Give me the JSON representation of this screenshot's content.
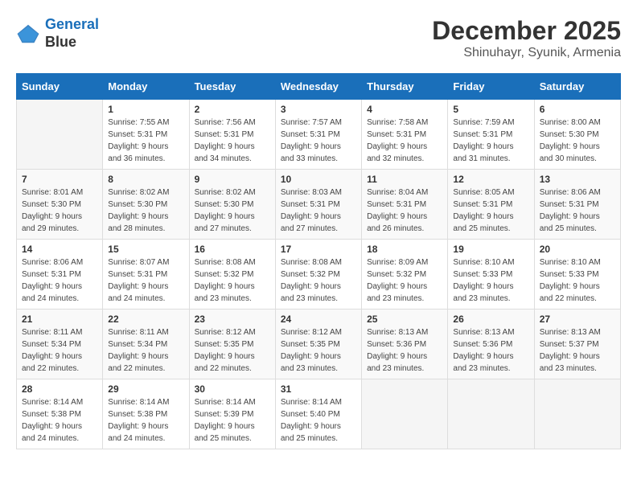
{
  "header": {
    "logo_line1": "General",
    "logo_line2": "Blue",
    "month": "December 2025",
    "location": "Shinuhayr, Syunik, Armenia"
  },
  "weekdays": [
    "Sunday",
    "Monday",
    "Tuesday",
    "Wednesday",
    "Thursday",
    "Friday",
    "Saturday"
  ],
  "weeks": [
    [
      {
        "day": "",
        "sunrise": "",
        "sunset": "",
        "daylight": ""
      },
      {
        "day": "1",
        "sunrise": "Sunrise: 7:55 AM",
        "sunset": "Sunset: 5:31 PM",
        "daylight": "Daylight: 9 hours and 36 minutes."
      },
      {
        "day": "2",
        "sunrise": "Sunrise: 7:56 AM",
        "sunset": "Sunset: 5:31 PM",
        "daylight": "Daylight: 9 hours and 34 minutes."
      },
      {
        "day": "3",
        "sunrise": "Sunrise: 7:57 AM",
        "sunset": "Sunset: 5:31 PM",
        "daylight": "Daylight: 9 hours and 33 minutes."
      },
      {
        "day": "4",
        "sunrise": "Sunrise: 7:58 AM",
        "sunset": "Sunset: 5:31 PM",
        "daylight": "Daylight: 9 hours and 32 minutes."
      },
      {
        "day": "5",
        "sunrise": "Sunrise: 7:59 AM",
        "sunset": "Sunset: 5:31 PM",
        "daylight": "Daylight: 9 hours and 31 minutes."
      },
      {
        "day": "6",
        "sunrise": "Sunrise: 8:00 AM",
        "sunset": "Sunset: 5:30 PM",
        "daylight": "Daylight: 9 hours and 30 minutes."
      }
    ],
    [
      {
        "day": "7",
        "sunrise": "Sunrise: 8:01 AM",
        "sunset": "Sunset: 5:30 PM",
        "daylight": "Daylight: 9 hours and 29 minutes."
      },
      {
        "day": "8",
        "sunrise": "Sunrise: 8:02 AM",
        "sunset": "Sunset: 5:30 PM",
        "daylight": "Daylight: 9 hours and 28 minutes."
      },
      {
        "day": "9",
        "sunrise": "Sunrise: 8:02 AM",
        "sunset": "Sunset: 5:30 PM",
        "daylight": "Daylight: 9 hours and 27 minutes."
      },
      {
        "day": "10",
        "sunrise": "Sunrise: 8:03 AM",
        "sunset": "Sunset: 5:31 PM",
        "daylight": "Daylight: 9 hours and 27 minutes."
      },
      {
        "day": "11",
        "sunrise": "Sunrise: 8:04 AM",
        "sunset": "Sunset: 5:31 PM",
        "daylight": "Daylight: 9 hours and 26 minutes."
      },
      {
        "day": "12",
        "sunrise": "Sunrise: 8:05 AM",
        "sunset": "Sunset: 5:31 PM",
        "daylight": "Daylight: 9 hours and 25 minutes."
      },
      {
        "day": "13",
        "sunrise": "Sunrise: 8:06 AM",
        "sunset": "Sunset: 5:31 PM",
        "daylight": "Daylight: 9 hours and 25 minutes."
      }
    ],
    [
      {
        "day": "14",
        "sunrise": "Sunrise: 8:06 AM",
        "sunset": "Sunset: 5:31 PM",
        "daylight": "Daylight: 9 hours and 24 minutes."
      },
      {
        "day": "15",
        "sunrise": "Sunrise: 8:07 AM",
        "sunset": "Sunset: 5:31 PM",
        "daylight": "Daylight: 9 hours and 24 minutes."
      },
      {
        "day": "16",
        "sunrise": "Sunrise: 8:08 AM",
        "sunset": "Sunset: 5:32 PM",
        "daylight": "Daylight: 9 hours and 23 minutes."
      },
      {
        "day": "17",
        "sunrise": "Sunrise: 8:08 AM",
        "sunset": "Sunset: 5:32 PM",
        "daylight": "Daylight: 9 hours and 23 minutes."
      },
      {
        "day": "18",
        "sunrise": "Sunrise: 8:09 AM",
        "sunset": "Sunset: 5:32 PM",
        "daylight": "Daylight: 9 hours and 23 minutes."
      },
      {
        "day": "19",
        "sunrise": "Sunrise: 8:10 AM",
        "sunset": "Sunset: 5:33 PM",
        "daylight": "Daylight: 9 hours and 23 minutes."
      },
      {
        "day": "20",
        "sunrise": "Sunrise: 8:10 AM",
        "sunset": "Sunset: 5:33 PM",
        "daylight": "Daylight: 9 hours and 22 minutes."
      }
    ],
    [
      {
        "day": "21",
        "sunrise": "Sunrise: 8:11 AM",
        "sunset": "Sunset: 5:34 PM",
        "daylight": "Daylight: 9 hours and 22 minutes."
      },
      {
        "day": "22",
        "sunrise": "Sunrise: 8:11 AM",
        "sunset": "Sunset: 5:34 PM",
        "daylight": "Daylight: 9 hours and 22 minutes."
      },
      {
        "day": "23",
        "sunrise": "Sunrise: 8:12 AM",
        "sunset": "Sunset: 5:35 PM",
        "daylight": "Daylight: 9 hours and 22 minutes."
      },
      {
        "day": "24",
        "sunrise": "Sunrise: 8:12 AM",
        "sunset": "Sunset: 5:35 PM",
        "daylight": "Daylight: 9 hours and 23 minutes."
      },
      {
        "day": "25",
        "sunrise": "Sunrise: 8:13 AM",
        "sunset": "Sunset: 5:36 PM",
        "daylight": "Daylight: 9 hours and 23 minutes."
      },
      {
        "day": "26",
        "sunrise": "Sunrise: 8:13 AM",
        "sunset": "Sunset: 5:36 PM",
        "daylight": "Daylight: 9 hours and 23 minutes."
      },
      {
        "day": "27",
        "sunrise": "Sunrise: 8:13 AM",
        "sunset": "Sunset: 5:37 PM",
        "daylight": "Daylight: 9 hours and 23 minutes."
      }
    ],
    [
      {
        "day": "28",
        "sunrise": "Sunrise: 8:14 AM",
        "sunset": "Sunset: 5:38 PM",
        "daylight": "Daylight: 9 hours and 24 minutes."
      },
      {
        "day": "29",
        "sunrise": "Sunrise: 8:14 AM",
        "sunset": "Sunset: 5:38 PM",
        "daylight": "Daylight: 9 hours and 24 minutes."
      },
      {
        "day": "30",
        "sunrise": "Sunrise: 8:14 AM",
        "sunset": "Sunset: 5:39 PM",
        "daylight": "Daylight: 9 hours and 25 minutes."
      },
      {
        "day": "31",
        "sunrise": "Sunrise: 8:14 AM",
        "sunset": "Sunset: 5:40 PM",
        "daylight": "Daylight: 9 hours and 25 minutes."
      },
      {
        "day": "",
        "sunrise": "",
        "sunset": "",
        "daylight": ""
      },
      {
        "day": "",
        "sunrise": "",
        "sunset": "",
        "daylight": ""
      },
      {
        "day": "",
        "sunrise": "",
        "sunset": "",
        "daylight": ""
      }
    ]
  ]
}
